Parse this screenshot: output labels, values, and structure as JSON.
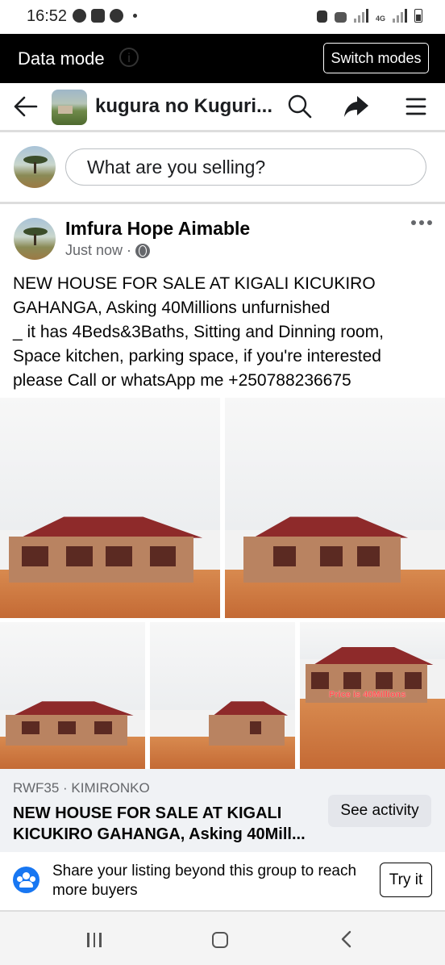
{
  "status_bar": {
    "time": "16:52",
    "network": "4G"
  },
  "data_mode_bar": {
    "label": "Data mode",
    "switch_label": "Switch modes"
  },
  "nav": {
    "title": "kugura no Kuguri..."
  },
  "composer": {
    "placeholder": "What are you selling?"
  },
  "post": {
    "author": "Imfura Hope Aimable",
    "timestamp": "Just now",
    "separator": "·",
    "text": "NEW HOUSE FOR SALE AT KIGALI KICUKIRO\nGAHANGA, Asking 40Millions unfurnished\n_ it has 4Beds&3Baths, Sitting and Dinning room,\nSpace kitchen, parking space, if you're interested\nplease Call or whatsApp me +250788236675",
    "photo_overlay_text": "Price is 40Millions"
  },
  "listing": {
    "price_location": "RWF35 · KIMIRONKO",
    "title": "NEW HOUSE FOR SALE AT KIGALI KICUKIRO GAHANGA, Asking 40Mill...",
    "activity_button": "See activity"
  },
  "share_prompt": {
    "text": "Share your listing beyond this group to reach more buyers",
    "button": "Try it"
  },
  "colors": {
    "accent": "#1877f2",
    "data_bar_bg": "#000000",
    "secondary_text": "#65676b",
    "listing_bg": "#f0f2f5"
  },
  "icons": [
    "back-arrow-icon",
    "search-icon",
    "share-arrow-icon",
    "menu-icon",
    "globe-icon",
    "more-options-icon",
    "people-icon"
  ]
}
